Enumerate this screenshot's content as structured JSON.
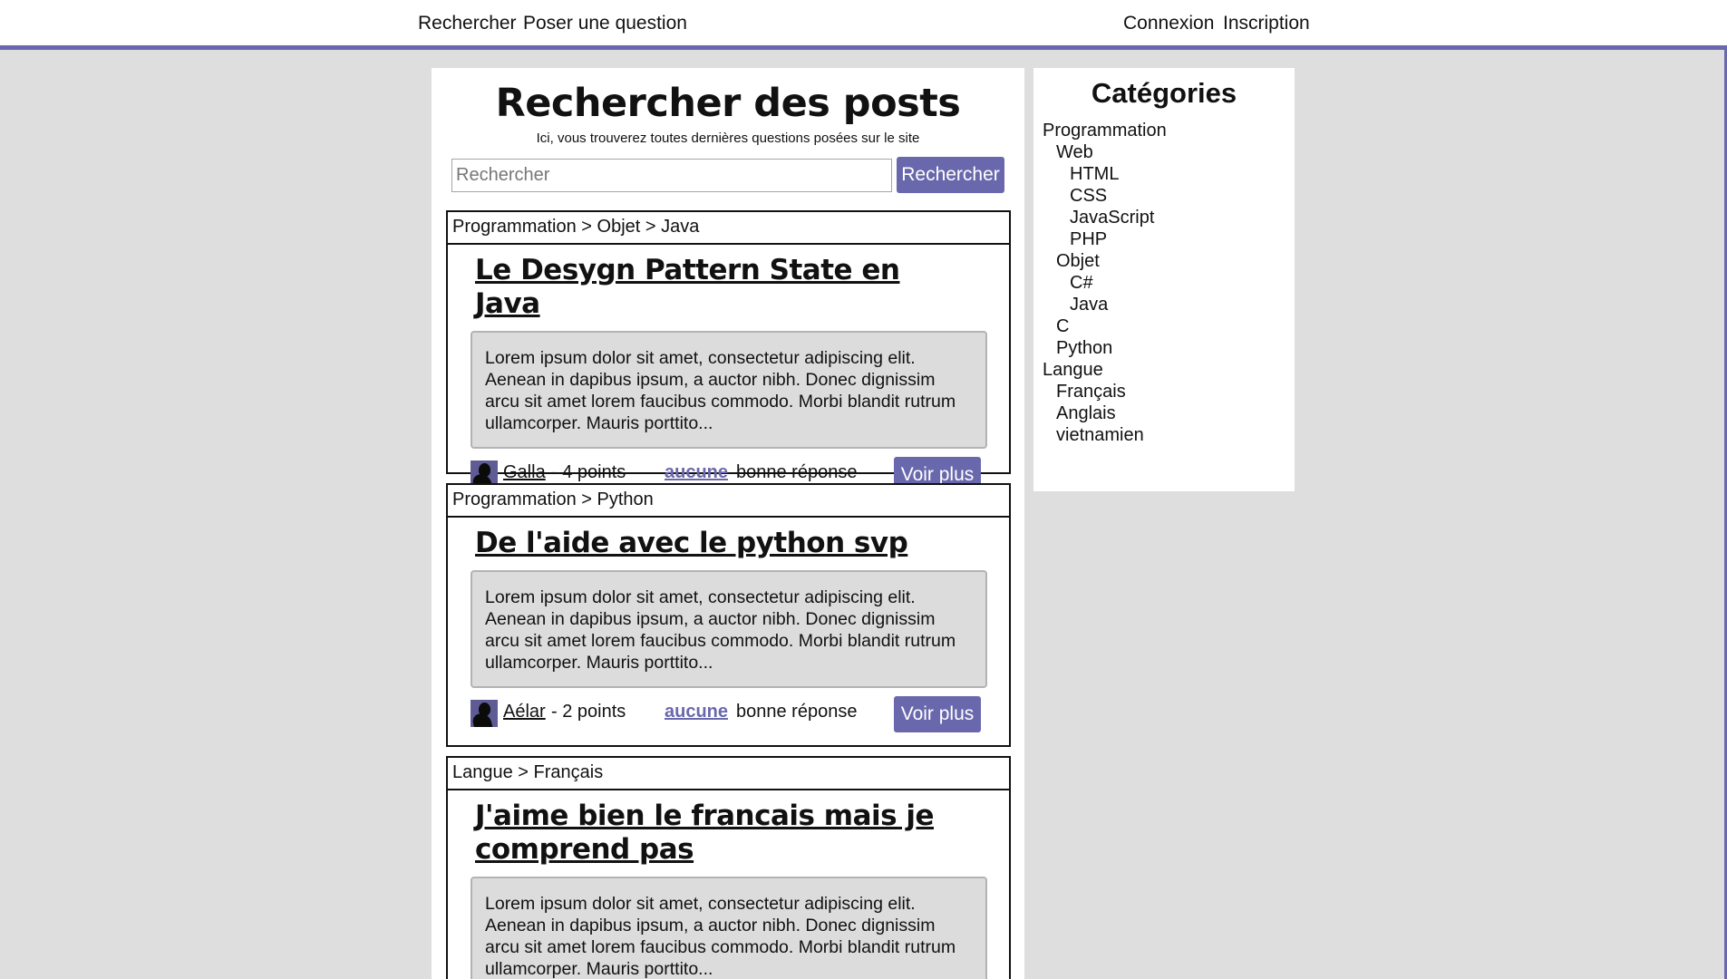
{
  "nav": {
    "search": "Rechercher",
    "ask": "Poser une question",
    "login": "Connexion",
    "register": "Inscription"
  },
  "main": {
    "title": "Rechercher des posts",
    "subtitle": "Ici, vous trouverez toutes dernières questions posées sur le site",
    "search_placeholder": "Rechercher",
    "search_button": "Rechercher"
  },
  "posts": [
    {
      "breadcrumb": "Programmation > Objet > Java",
      "title": "Le Desygn Pattern State en Java",
      "excerpt": "Lorem ipsum dolor sit amet, consectetur adipiscing elit. Aenean in dapibus ipsum, a auctor nibh. Donec dignissim arcu sit amet lorem faucibus commodo. Morbi blandit rutrum ullamcorper. Mauris porttito...",
      "author": "Galla",
      "points": "- 4 points",
      "answers_link": "aucune",
      "answers_text": "bonne réponse",
      "more_button": "Voir plus"
    },
    {
      "breadcrumb": "Programmation > Python",
      "title": "De l'aide avec le python svp",
      "excerpt": "Lorem ipsum dolor sit amet, consectetur adipiscing elit. Aenean in dapibus ipsum, a auctor nibh. Donec dignissim arcu sit amet lorem faucibus commodo. Morbi blandit rutrum ullamcorper. Mauris porttito...",
      "author": "Aélar",
      "points": "- 2 points",
      "answers_link": "aucune",
      "answers_text": "bonne réponse",
      "more_button": "Voir plus"
    },
    {
      "breadcrumb": "Langue > Français",
      "title": "J'aime bien le francais mais je comprend pas",
      "excerpt": "Lorem ipsum dolor sit amet, consectetur adipiscing elit. Aenean in dapibus ipsum, a auctor nibh. Donec dignissim arcu sit amet lorem faucibus commodo. Morbi blandit rutrum ullamcorper. Mauris porttito..."
    }
  ],
  "sidebar": {
    "title": "Catégories",
    "categories": [
      "Programmation",
      "Web",
      "HTML",
      "CSS",
      "JavaScript",
      "PHP",
      "Objet",
      "C#",
      "Java",
      "C",
      "Python",
      "Langue",
      "Français",
      "Anglais",
      "vietnamien"
    ]
  },
  "colors": {
    "accent": "#6a68ad",
    "background": "#dedede",
    "excerpt_bg": "#dcdcdc"
  }
}
